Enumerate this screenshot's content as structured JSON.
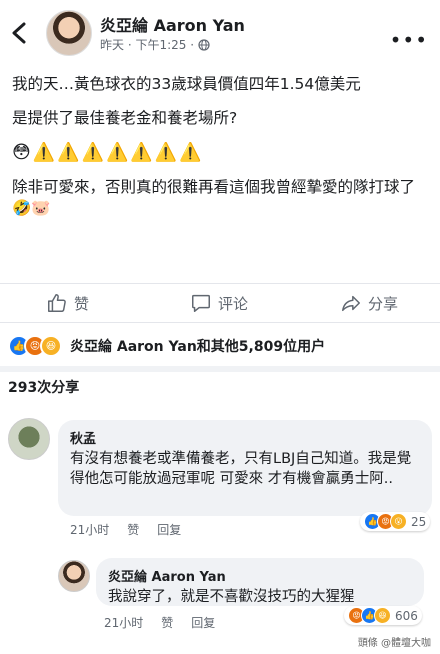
{
  "post": {
    "author": "炎亞綸 Aaron Yan",
    "time": "昨天 · 下午1:25 ·",
    "paragraph1": "我的天…黃色球衣的33歲球員價值四年1.54億美元",
    "paragraph2": "是提供了最佳養老金和養老場所?",
    "emoji_line": "😳⚠️⚠️⚠️⚠️⚠️⚠️⚠️",
    "paragraph3": "除非可愛來，否則真的很難再看這個我曾經摯愛的隊打球了🤣🐷"
  },
  "actions": {
    "like": "赞",
    "comment": "评论",
    "share": "分享"
  },
  "reactions": {
    "summary": "炎亞綸 Aaron Yan和其他5,809位用户"
  },
  "shares": {
    "count_text": "293次分享"
  },
  "comments": [
    {
      "name": "秋孟",
      "text": "有沒有想養老或準備養老，只有LBJ自己知道。我是覺得他怎可能放過冠軍呢 可愛來 才有機會贏勇士阿..",
      "time": "21小时",
      "like": "赞",
      "reply": "回复",
      "reaction_count": "25"
    },
    {
      "name": "炎亞綸 Aaron Yan",
      "text": "我說穿了，就是不喜歡沒技巧的大猩猩",
      "time": "21小时",
      "like": "赞",
      "reply": "回复",
      "reaction_count": "606"
    }
  ],
  "watermark": "頭條 @體壇大咖"
}
